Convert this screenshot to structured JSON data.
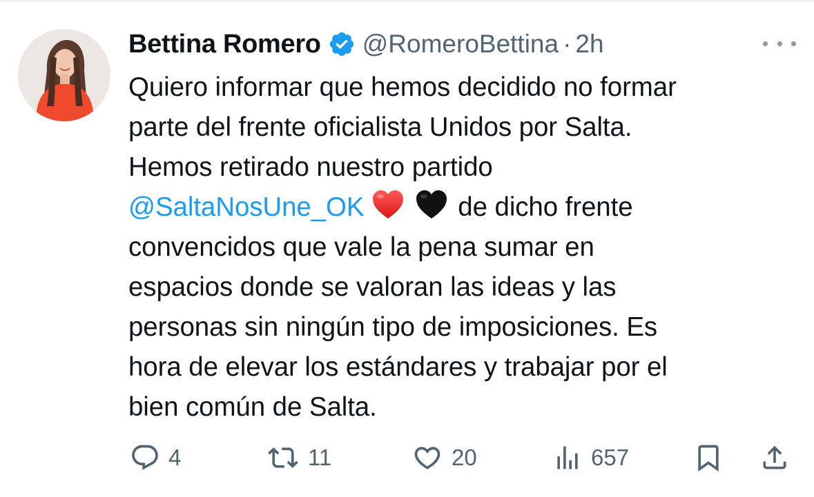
{
  "tweet": {
    "author": {
      "display_name": "Bettina Romero",
      "handle": "@RomeroBettina",
      "verified": true,
      "avatar_icon": "profile-photo"
    },
    "separator": "·",
    "timestamp": "2h",
    "text_lines": [
      "Quiero informar que hemos decidido no formar",
      "parte del frente oficialista Unidos por Salta.",
      "Hemos retirado nuestro partido",
      "convencidos que vale la pena sumar en",
      "espacios donde se valoran las ideas y las",
      "personas sin ningún tipo de imposiciones. Es",
      "hora de elevar los estándares y trabajar por el",
      "bien común de Salta."
    ],
    "mention_line": {
      "mention": "@SaltaNosUne_OK",
      "emojis": [
        "red-heart-emoji",
        "black-heart-emoji"
      ],
      "after_text": "de dicho frente"
    },
    "actions": {
      "replies": "4",
      "reposts": "11",
      "likes": "20",
      "views": "657"
    }
  },
  "colors": {
    "text": "#0f1419",
    "secondary": "#536471",
    "link": "#1d9bf0",
    "verified_badge": "#1d9bf0"
  }
}
